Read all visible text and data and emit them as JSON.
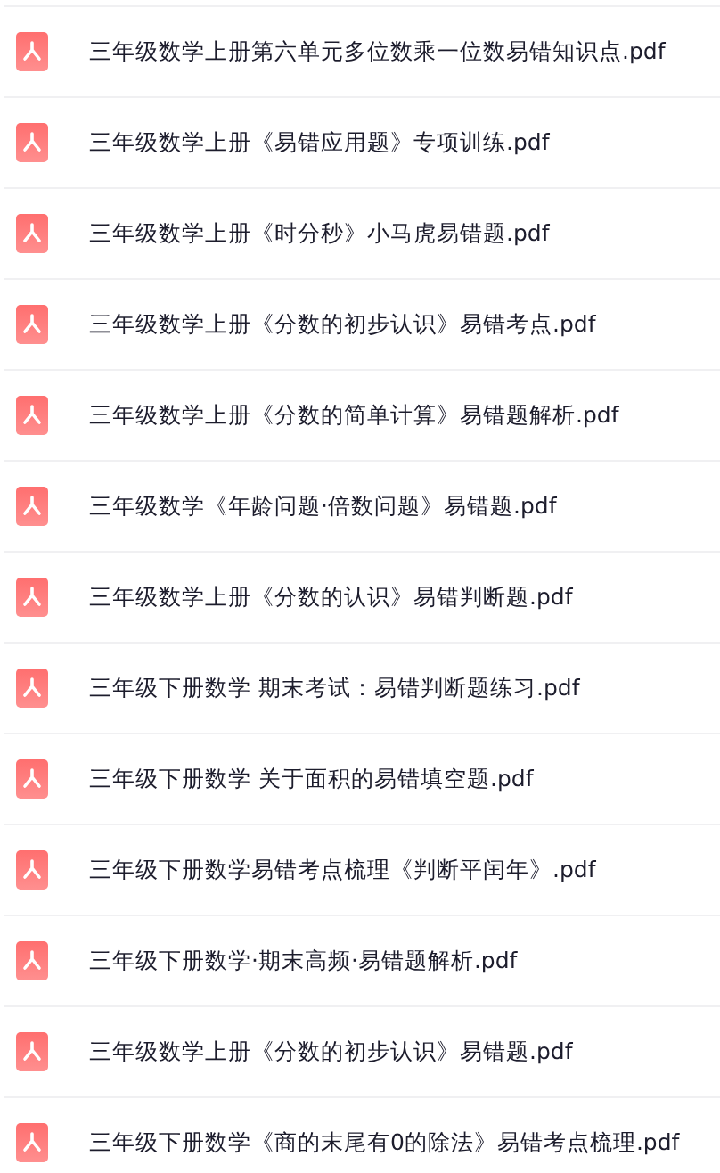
{
  "files": [
    {
      "name": "三年级数学上册第六单元多位数乘一位数易错知识点.pdf"
    },
    {
      "name": "三年级数学上册《易错应用题》专项训练.pdf"
    },
    {
      "name": "三年级数学上册《时分秒》小马虎易错题.pdf"
    },
    {
      "name": "三年级数学上册《分数的初步认识》易错考点.pdf"
    },
    {
      "name": "三年级数学上册《分数的简单计算》易错题解析.pdf"
    },
    {
      "name": "三年级数学《年龄问题·倍数问题》易错题.pdf"
    },
    {
      "name": "三年级数学上册《分数的认识》易错判断题.pdf"
    },
    {
      "name": "三年级下册数学 期末考试：易错判断题练习.pdf"
    },
    {
      "name": "三年级下册数学 关于面积的易错填空题.pdf"
    },
    {
      "name": "三年级下册数学易错考点梳理《判断平闰年》.pdf"
    },
    {
      "name": "三年级下册数学·期末高频·易错题解析.pdf"
    },
    {
      "name": "三年级数学上册《分数的初步认识》易错题.pdf"
    },
    {
      "name": "三年级下册数学《商的末尾有0的除法》易错考点梳理.pdf"
    }
  ]
}
